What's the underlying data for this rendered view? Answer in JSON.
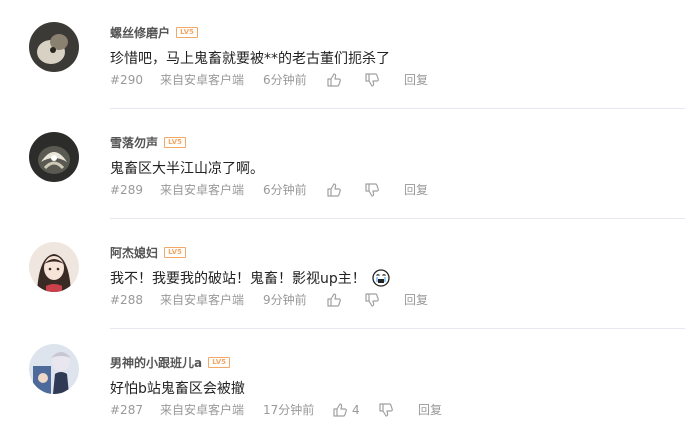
{
  "comments": [
    {
      "username": "螺丝修磨户",
      "level": "LV5",
      "text": "珍惜吧，马上鬼畜就要被**的老古董们扼杀了",
      "floor": "#290",
      "source": "来自安卓客户端",
      "time": "6分钟前",
      "likes": "",
      "reply": "回复"
    },
    {
      "username": "雪落勿声",
      "level": "LV5",
      "text": "鬼畜区大半江山凉了啊。",
      "floor": "#289",
      "source": "来自安卓客户端",
      "time": "6分钟前",
      "likes": "",
      "reply": "回复"
    },
    {
      "username": "阿杰媳妇",
      "level": "LV5",
      "text": "我不！我要我的破站！鬼畜！影视up主！",
      "floor": "#288",
      "source": "来自安卓客户端",
      "time": "9分钟前",
      "likes": "",
      "reply": "回复"
    },
    {
      "username": "男神的小跟班儿a",
      "level": "LV5",
      "text": "好怕b站鬼畜区会被撤",
      "floor": "#287",
      "source": "来自安卓客户端",
      "time": "17分钟前",
      "likes": "4",
      "reply": "回复"
    }
  ],
  "icons": {
    "like": "thumbs-up-icon",
    "dislike": "thumbs-down-icon",
    "emoji": "crying-face-icon"
  },
  "colors": {
    "level_badge": "#f2a867",
    "username": "#555555",
    "meta": "#999999",
    "divider": "#e5e9ef"
  }
}
